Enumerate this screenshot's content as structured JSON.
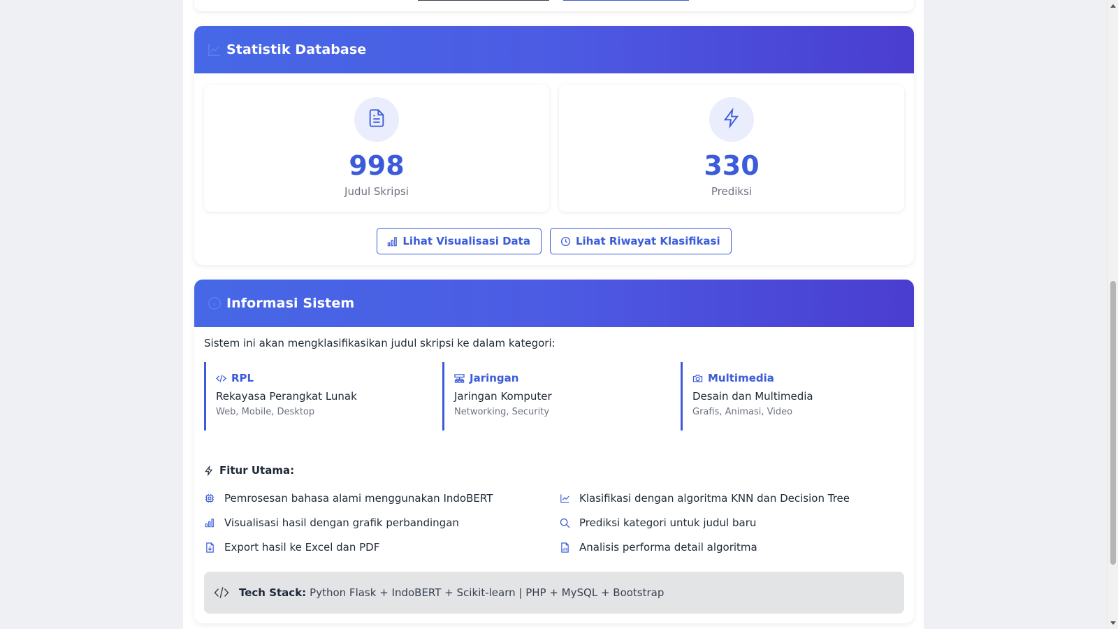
{
  "stats": {
    "title": "Statistik Database",
    "items": [
      {
        "value": "998",
        "label": "Judul Skripsi",
        "icon": "document-icon"
      },
      {
        "value": "330",
        "label": "Prediksi",
        "icon": "lightning-icon"
      }
    ],
    "buttons": {
      "visualisasi": "Lihat Visualisasi Data",
      "riwayat": "Lihat Riwayat Klasifikasi"
    }
  },
  "info": {
    "title": "Informasi Sistem",
    "intro": "Sistem ini akan mengklasifikasikan judul skripsi ke dalam kategori:",
    "categories": [
      {
        "code": "RPL",
        "name": "Rekayasa Perangkat Lunak",
        "examples": "Web, Mobile, Desktop",
        "icon": "code-icon"
      },
      {
        "code": "Jaringan",
        "name": "Jaringan Komputer",
        "examples": "Networking, Security",
        "icon": "network-icon"
      },
      {
        "code": "Multimedia",
        "name": "Desain dan Multimedia",
        "examples": "Grafis, Animasi, Video",
        "icon": "camera-icon"
      }
    ],
    "features_title": "Fitur Utama:",
    "features": [
      {
        "text": "Pemrosesan bahasa alami menggunakan IndoBERT",
        "icon": "cpu-icon"
      },
      {
        "text": "Klasifikasi dengan algoritma KNN dan Decision Tree",
        "icon": "line-chart-icon"
      },
      {
        "text": "Visualisasi hasil dengan grafik perbandingan",
        "icon": "bar-chart-icon"
      },
      {
        "text": "Prediksi kategori untuk judul baru",
        "icon": "search-icon"
      },
      {
        "text": "Export hasil ke Excel dan PDF",
        "icon": "file-export-icon"
      },
      {
        "text": "Analisis performa detail algoritma",
        "icon": "file-chart-icon"
      }
    ],
    "tech_label": "Tech Stack:",
    "tech_value": "Python Flask + IndoBERT + Scikit-learn | PHP + MySQL + Bootstrap"
  },
  "colors": {
    "accent": "#3b5bdb",
    "header_gradient_start": "#4668e6",
    "header_gradient_end": "#4a3dd0"
  }
}
